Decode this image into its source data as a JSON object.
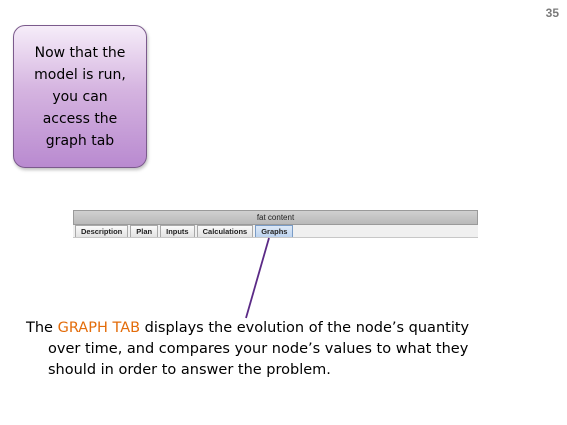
{
  "slide": {
    "page_number": "35"
  },
  "callout": {
    "text": "Now that the\nmodel is run,\nyou can\naccess the\ngraph tab"
  },
  "app_window": {
    "title": "fat content",
    "tabs": [
      {
        "label": "Description",
        "active": false
      },
      {
        "label": "Plan",
        "active": false
      },
      {
        "label": "Inputs",
        "active": false
      },
      {
        "label": "Calculations",
        "active": false
      },
      {
        "label": "Graphs",
        "active": true
      }
    ]
  },
  "explanation": {
    "prefix": "The ",
    "highlight": "GRAPH TAB",
    "line1_rest": " displays the evolution of the node’s quantity",
    "line2": "over time, and compares your node’s values to what they",
    "line3": "should in order to answer the problem."
  },
  "colors": {
    "highlight": "#e36c0a",
    "pointer_line": "#5b2a86",
    "callout_border": "#7b5a8c"
  }
}
